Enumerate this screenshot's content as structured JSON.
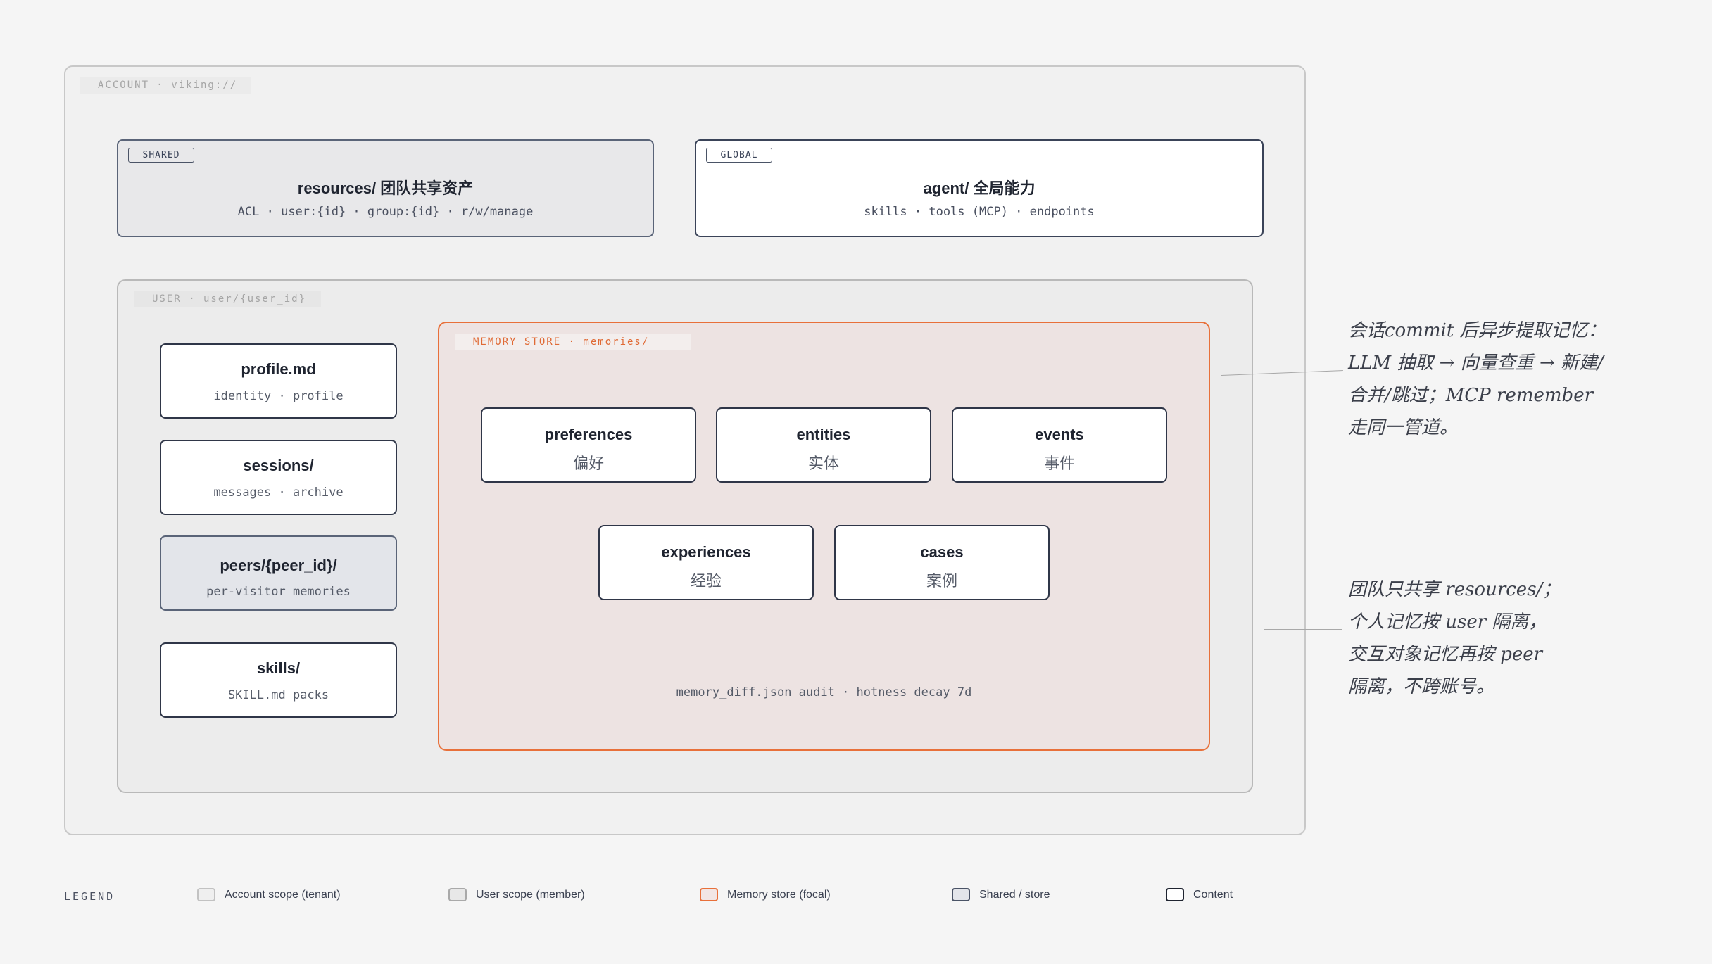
{
  "account": {
    "tag": "ACCOUNT · viking://"
  },
  "shared": {
    "badge": "SHARED",
    "title": "resources/ 团队共享资产",
    "subtitle": "ACL · user:{id} · group:{id} · r/w/manage"
  },
  "global": {
    "badge": "GLOBAL",
    "title": "agent/ 全局能力",
    "subtitle": "skills · tools (MCP) · endpoints"
  },
  "user": {
    "tag": "USER · user/{user_id}",
    "items": [
      {
        "title": "profile.md",
        "subtitle": "identity · profile"
      },
      {
        "title": "sessions/",
        "subtitle": "messages · archive"
      },
      {
        "title": "peers/{peer_id}/",
        "subtitle": "per-visitor memories"
      },
      {
        "title": "skills/",
        "subtitle": "SKILL.md packs"
      }
    ]
  },
  "memory": {
    "tag": "MEMORY STORE · memories/",
    "items": [
      {
        "title": "preferences",
        "subtitle": "偏好"
      },
      {
        "title": "entities",
        "subtitle": "实体"
      },
      {
        "title": "events",
        "subtitle": "事件"
      },
      {
        "title": "experiences",
        "subtitle": "经验"
      },
      {
        "title": "cases",
        "subtitle": "案例"
      }
    ],
    "footer": "memory_diff.json audit · hotness decay 7d"
  },
  "notes": {
    "commit": [
      "会话commit 后异步提取记忆：",
      "LLM 抽取 → 向量查重 → 新建/",
      "合并/跳过；MCP remember",
      "走同一管道。"
    ],
    "isolation": [
      "团队只共享 resources/；",
      "个人记忆按 user 隔离，",
      "交互对象记忆再按 peer",
      "隔离，不跨账号。"
    ]
  },
  "legend": {
    "title": "LEGEND",
    "items": [
      "Account scope (tenant)",
      "User scope (member)",
      "Memory store (focal)",
      "Shared / store",
      "Content"
    ]
  }
}
